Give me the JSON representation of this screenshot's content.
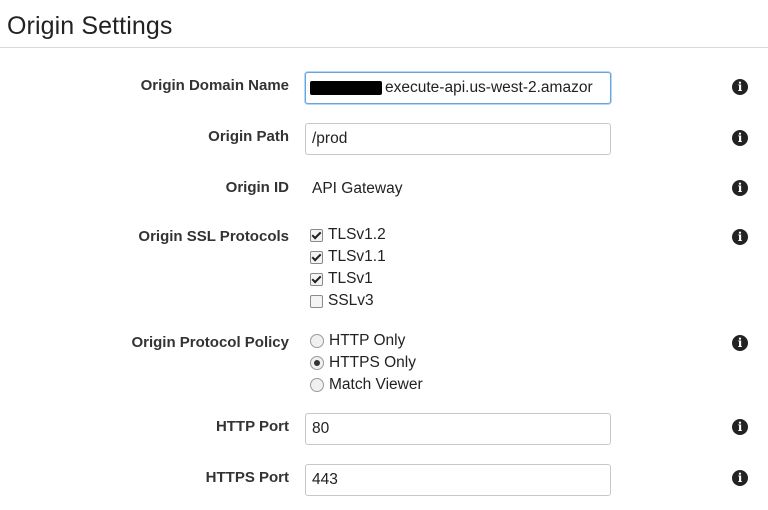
{
  "section": {
    "title": "Origin Settings"
  },
  "fields": {
    "origin_domain_name": {
      "label": "Origin Domain Name",
      "value": "execute-api.us-west-2.amazor"
    },
    "origin_path": {
      "label": "Origin Path",
      "value": "/prod"
    },
    "origin_id": {
      "label": "Origin ID",
      "value": "API Gateway"
    },
    "ssl_protocols": {
      "label": "Origin SSL Protocols",
      "options": [
        {
          "label": "TLSv1.2",
          "checked": true
        },
        {
          "label": "TLSv1.1",
          "checked": true
        },
        {
          "label": "TLSv1",
          "checked": true
        },
        {
          "label": "SSLv3",
          "checked": false
        }
      ]
    },
    "protocol_policy": {
      "label": "Origin Protocol Policy",
      "options": [
        {
          "label": "HTTP Only",
          "selected": false
        },
        {
          "label": "HTTPS Only",
          "selected": true
        },
        {
          "label": "Match Viewer",
          "selected": false
        }
      ]
    },
    "http_port": {
      "label": "HTTP Port",
      "value": "80"
    },
    "https_port": {
      "label": "HTTPS Port",
      "value": "443"
    }
  },
  "icons": {
    "info": "info-circle-icon",
    "info_glyph": "i"
  }
}
